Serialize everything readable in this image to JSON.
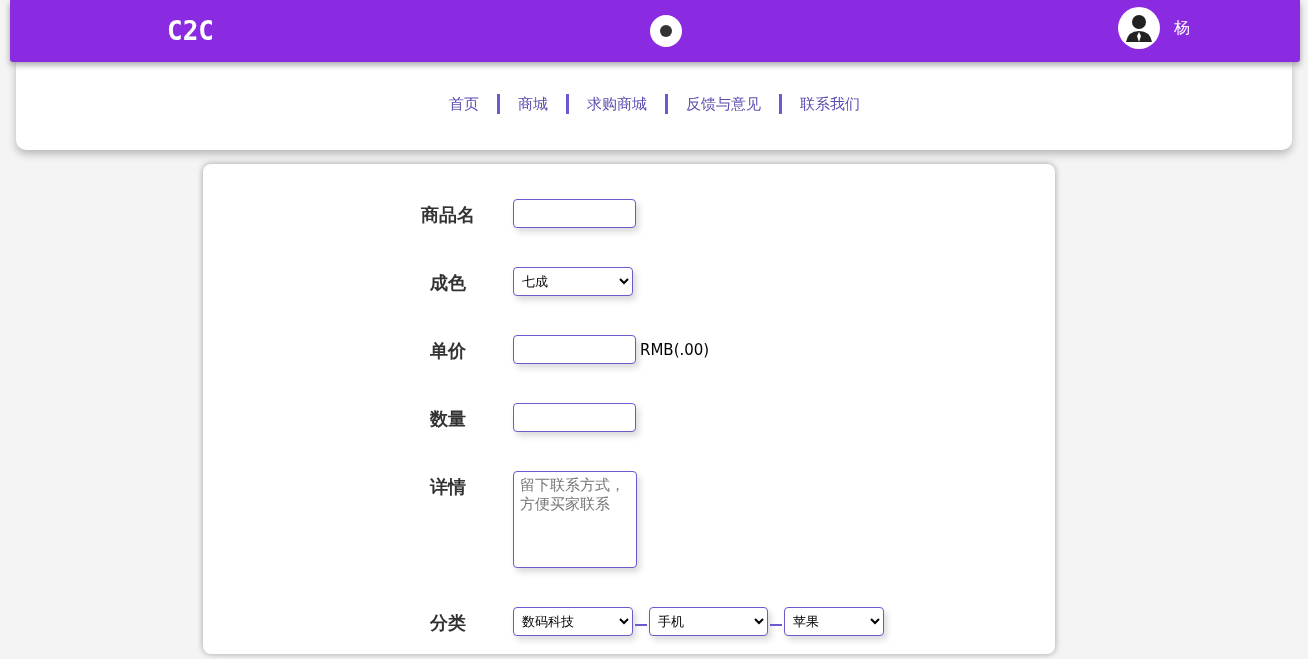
{
  "header": {
    "logo": "C2C",
    "user_name": "杨"
  },
  "nav": [
    {
      "label": "首页"
    },
    {
      "label": "商城"
    },
    {
      "label": "求购商城"
    },
    {
      "label": "反馈与意见"
    },
    {
      "label": "联系我们"
    }
  ],
  "form": [
    {
      "kind": "text",
      "label": "商品名"
    },
    {
      "kind": "select",
      "label": "成色",
      "value": "七成"
    },
    {
      "kind": "text",
      "label": "单价",
      "suffix": "RMB(.00)"
    },
    {
      "kind": "text",
      "label": "数量"
    },
    {
      "kind": "textarea",
      "label": "详情",
      "placeholder": "留下联系方式，方便买家联系"
    },
    {
      "kind": "chain",
      "label": "分类",
      "values": [
        "数码科技",
        "手机",
        "苹果"
      ]
    }
  ]
}
